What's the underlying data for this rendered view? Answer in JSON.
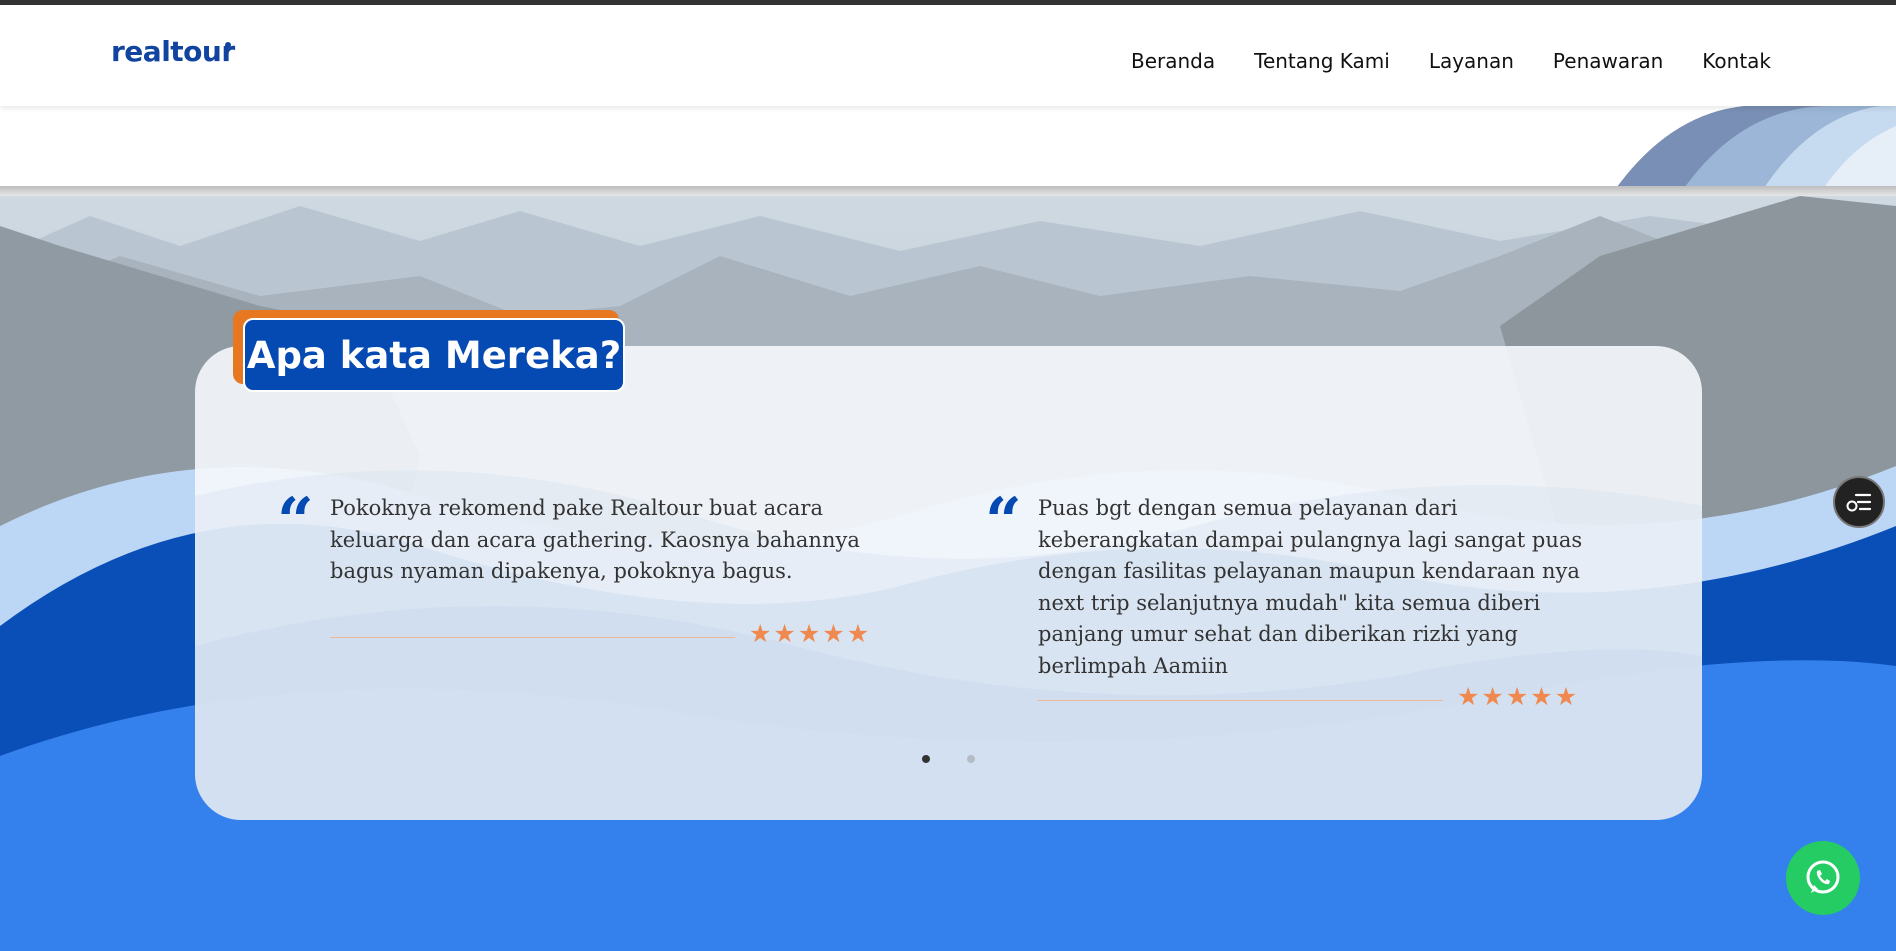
{
  "brand": {
    "name": "realtour"
  },
  "nav": {
    "items": [
      {
        "label": "Beranda"
      },
      {
        "label": "Tentang Kami"
      },
      {
        "label": "Layanan"
      },
      {
        "label": "Penawaran"
      },
      {
        "label": "Kontak"
      }
    ]
  },
  "section": {
    "title": "Apa kata Mereka?"
  },
  "testimonials": [
    {
      "quote_mark": "“",
      "text": "Pokoknya rekomend pake Realtour buat acara keluarga dan acara gathering. Kaosnya bahannya bagus nyaman dipakenya, pokoknya bagus.",
      "rating": 5
    },
    {
      "quote_mark": "“",
      "text": "Puas bgt dengan semua pelayanan dari keberangkatan dampai pulangnya lagi sangat puas dengan fasilitas pelayanan maupun kendaraan nya next trip selanjutnya mudah\" kita semua diberi panjang umur sehat dan diberikan rizki yang berlimpah Aamiin",
      "rating": 5
    }
  ],
  "carousel": {
    "pages": 2,
    "active": 1
  },
  "icons": {
    "side_button": "menu-list-icon",
    "floating_button": "whatsapp-icon"
  },
  "colors": {
    "brand_blue": "#0549b3",
    "accent_orange": "#e87722",
    "star": "#f0894f",
    "whatsapp": "#24cc63",
    "footer_blue": "#3480ec"
  }
}
